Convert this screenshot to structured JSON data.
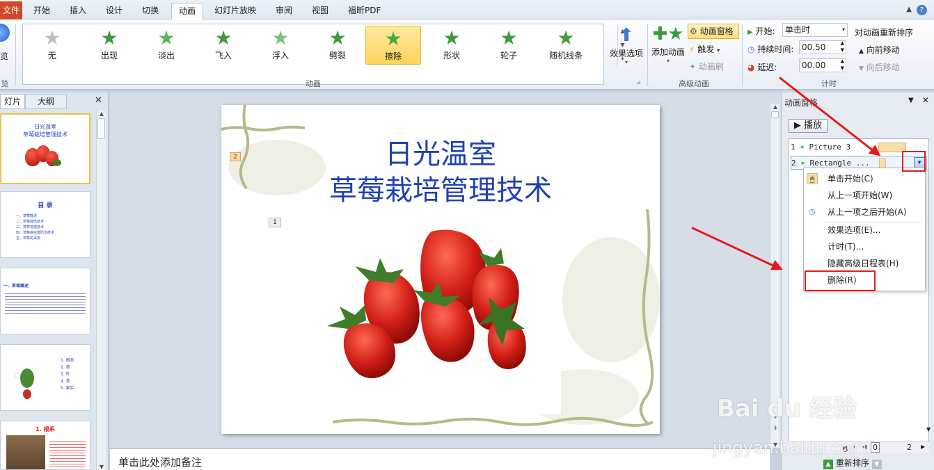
{
  "tabs": {
    "file": "文件",
    "items": [
      "开始",
      "插入",
      "设计",
      "切换",
      "动画",
      "幻灯片放映",
      "审阅",
      "视图",
      "福昕PDF"
    ],
    "active": "动画"
  },
  "ribbon": {
    "preview_label": "览",
    "preview_group": "览",
    "animations": [
      "无",
      "出现",
      "淡出",
      "飞入",
      "浮入",
      "劈裂",
      "擦除",
      "形状",
      "轮子",
      "随机线条"
    ],
    "selected_animation": "擦除",
    "effect_options": "效果选项",
    "animation_group": "动画",
    "add_animation": "添加动画",
    "anim_pane_btn": "动画窗格",
    "trigger": "触发",
    "anim_painter": "动画刷",
    "advanced_group": "高级动画",
    "start_label": "开始:",
    "start_value": "单击时",
    "duration_label": "持续时间:",
    "duration_value": "00.50",
    "delay_label": "延迟:",
    "delay_value": "00.00",
    "reorder_title": "对动画重新排序",
    "move_earlier": "向前移动",
    "move_later": "向后移动",
    "timing_group": "计时"
  },
  "left_panel": {
    "tab_slides": "灯片",
    "tab_outline": "大纲",
    "close": "✕",
    "thumbs": [
      {
        "title1": "日光温室",
        "title2": "草莓栽培管理技术"
      },
      {
        "title": "目  录",
        "lines": [
          "一、草莓概述",
          "二、草莓栽培技术",
          "三、草莓管理技术",
          "四、草莓病虫害防治技术",
          "五、草莓的采收"
        ]
      },
      {
        "title": "一、草莓概述"
      },
      {
        "lines": [
          "1. 根系",
          "2. 茎",
          "3. 叶",
          "4. 花",
          "5. 果实"
        ]
      },
      {
        "title": "1. 根系"
      }
    ]
  },
  "slide": {
    "title1": "日光温室",
    "title2": "草莓栽培管理技术",
    "tag1": "1",
    "tag2": "2"
  },
  "notes_placeholder": "单击此处添加备注",
  "anim_pane": {
    "title": "动画窗格",
    "play": "▶ 播放",
    "items": [
      {
        "num": "1",
        "name": "Picture 3"
      },
      {
        "num": "2",
        "name": "Rectangle ..."
      }
    ],
    "menu": [
      "单击开始(C)",
      "从上一项开始(W)",
      "从上一项之后开始(A)",
      "效果选项(E)...",
      "计时(T)...",
      "隐藏高级日程表(H)",
      "删除(R)"
    ],
    "seconds_label": "秒",
    "timeline_0": "0",
    "timeline_2": "2",
    "reorder_label": "重新排序"
  },
  "watermark": {
    "brand": "Bai du 经验",
    "url": "jingyan.baidu.com"
  },
  "colors": {
    "title_blue": "#1f3fb5",
    "accent_red": "#e61919",
    "file_tab": "#d24726",
    "selected_gold": "#ffd45a"
  }
}
